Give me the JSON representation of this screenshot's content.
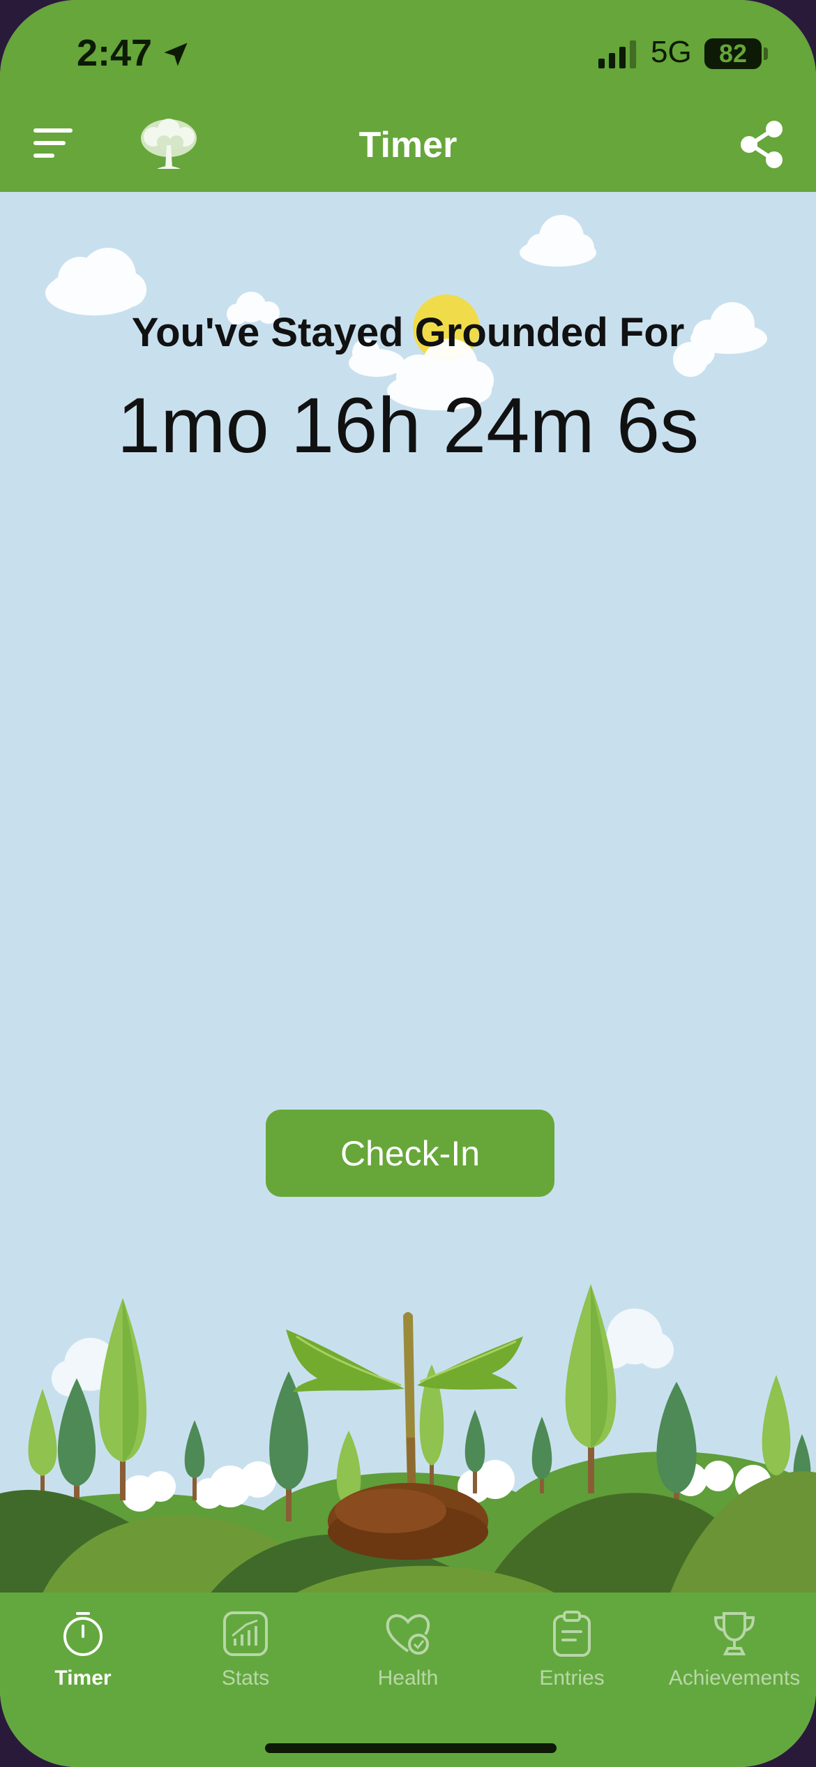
{
  "status_bar": {
    "time": "2:47",
    "network": "5G",
    "battery": "82"
  },
  "header": {
    "title": "Timer"
  },
  "main": {
    "headline": "You've Stayed Grounded For",
    "duration": "1mo 16h 24m 6s",
    "checkin_label": "Check-In"
  },
  "tabbar": {
    "tabs": [
      {
        "label": "Timer",
        "icon": "stopwatch-icon",
        "active": true
      },
      {
        "label": "Stats",
        "icon": "chart-icon",
        "active": false
      },
      {
        "label": "Health",
        "icon": "heart-check-icon",
        "active": false
      },
      {
        "label": "Entries",
        "icon": "clipboard-icon",
        "active": false
      },
      {
        "label": "Achievements",
        "icon": "trophy-icon",
        "active": false
      }
    ]
  },
  "colors": {
    "header_green": "#66a63a",
    "sky": "#c8e0ee",
    "tabbar_green": "#63a83e",
    "button_green": "#67a739"
  }
}
